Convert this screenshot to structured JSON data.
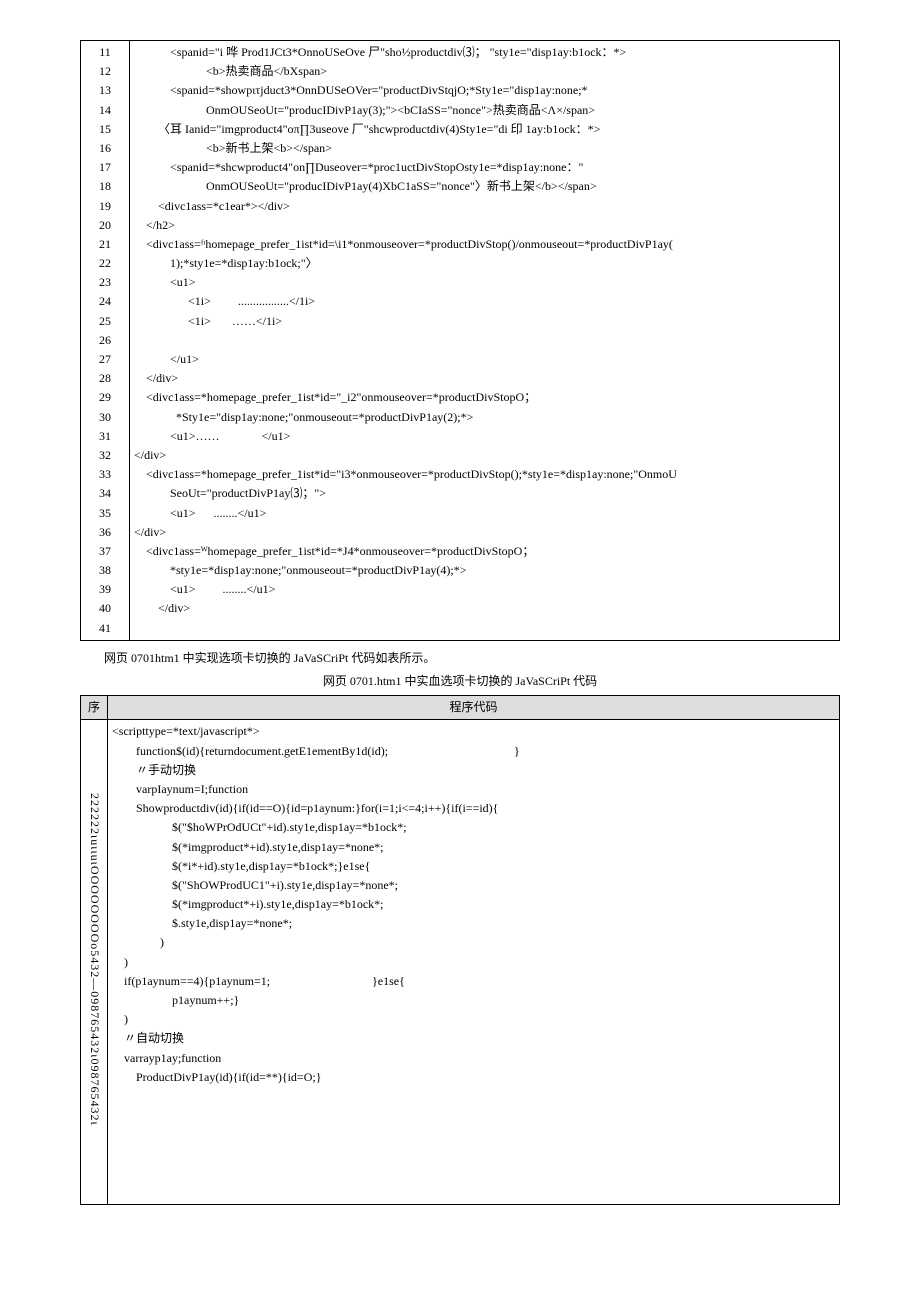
{
  "table1": {
    "line_numbers": [
      "11",
      "12",
      "13",
      "14",
      "15",
      "16",
      "17",
      "18",
      "19",
      "20",
      "21",
      "22",
      "23",
      "24",
      "25",
      "26",
      "27",
      "28",
      "29",
      "30",
      "31",
      "32",
      "33",
      "34",
      "35",
      "36",
      "37",
      "38",
      "39",
      "40",
      "41"
    ],
    "code_lines": [
      "            <spanid=\"i 哗 Prod1JCt3*OnnoUSeOve 尸\"sho½productdiv⑶； \"sty1e=\"disp1ay:b1ock：*>",
      "                        <b>热卖商品</bXspan>",
      "            <spanid=*showpιτjduct3*OnnDUSeOVer=\"productDivStqjO;*Sty1e=\"disp1ay:none;*",
      "                        OnmOUSeoUt=\"producIDivP1ay(3);\"><bCIaSS=\"nonce\">热卖商品<Λ×/span>",
      "        〈耳 Ianid=\"imgproduct4\"oπ∏3useove 厂\"shcwproductdiv(4)Sty1e=\"di 印 1ay:b1ock：*>",
      "                        <b>新书上架<b></span>",
      "            <spanid=*shcwproduct4\"on∏Duseover=*proc1uctDivStopOsty1e=*disp1ay:none：\"",
      "                        OnmOUSeoUt=\"producIDivP1ay(4)XbC1aSS=\"nonce\"〉新书上架</b></span>",
      "        <divc1ass=*c1ear*></div>",
      "    </h2>",
      "    <divc1ass=ᶠᶦhomepage_prefer_1ist*id=\\i1*onmouseover=*productDivStop()/onmouseout=*productDivP1ay(",
      "            1);*sty1e=*disp1ay:b1ock;\"〉",
      "            <u1>",
      "                  <1i>         .................</1i>",
      "                  <1i>       ……</1i>",
      "",
      "            </u1>",
      "    </div>",
      "    <divc1ass=*homepage_prefer_1ist*id=\"_i2\"onmouseover=*productDivStopO；",
      "              *Sty1e=\"disp1ay:none;\"onmouseout=*productDivP1ay(2);*>",
      "            <u1>……              </u1>",
      "</div>",
      "    <divc1ass=*homepage_prefer_1ist*id=\"i3*onmouseover=*productDivStop();*sty1e=*disp1ay:none;\"OnmoU",
      "            SeoUt=\"productDivP1ay⑶；\">",
      "            <u1>      ........</u1>",
      "</div>",
      "    <divc1ass=ᵂhomepage_prefer_1ist*id=*J4*onmouseover=*productDivStopO；",
      "            *sty1e=*disp1ay:none;\"onmouseout=*productDivP1ay(4);*>",
      "            <u1>         ........</u1>",
      "        </div>"
    ]
  },
  "intro_text": "网页 0701htm1 中实现选项卡切换的 JaVaSCriPt 代码如表所示。",
  "caption_text": "网页 0701.htm1 中实血选项卡切换的 JaVaSCriPt 代码",
  "table2": {
    "header_left": "序",
    "header_right": "程序代码",
    "vertical_text": "222222ιuιιuιOOOOOOOOo5432—098765432ι098765432ι",
    "code_lines": [
      "<scripttype=*text/javascript*>",
      "        function$(id){returndocument.getE1ementBy1d(id);                                          }",
      "        〃手动切换",
      "        varpIaynum=I;function",
      "        Showproductdiv(id){if(id==O){id=p1aynum:}for(i=1;i<=4;i++){if(i==id){",
      "                    $(\"$hoWPrOdUCt\"+id).sty1e,disp1ay=*b1ock*;",
      "                    $(*imgproduct*+id).sty1e,disp1ay=*none*;",
      "                    $(*i*+id).sty1e,disp1ay=*b1ock*;}e1se{",
      "                    $(\"ShOWProdUC1\"+i).sty1e,disp1ay=*none*;",
      "                    $(*imgproduct*+i).sty1e,disp1ay=*b1ock*;",
      "                    $.sty1e,disp1ay=*none*;",
      "                )",
      "    )",
      "    if(p1aynum==4){p1aynum=1;                                  }e1se{",
      "                    p1aynum++;}",
      "    )",
      "    〃自动切换",
      "    varrayp1ay;function",
      "        ProductDivP1ay(id){if(id=**){id=O;}",
      "",
      "",
      "",
      "",
      "",
      ""
    ]
  }
}
